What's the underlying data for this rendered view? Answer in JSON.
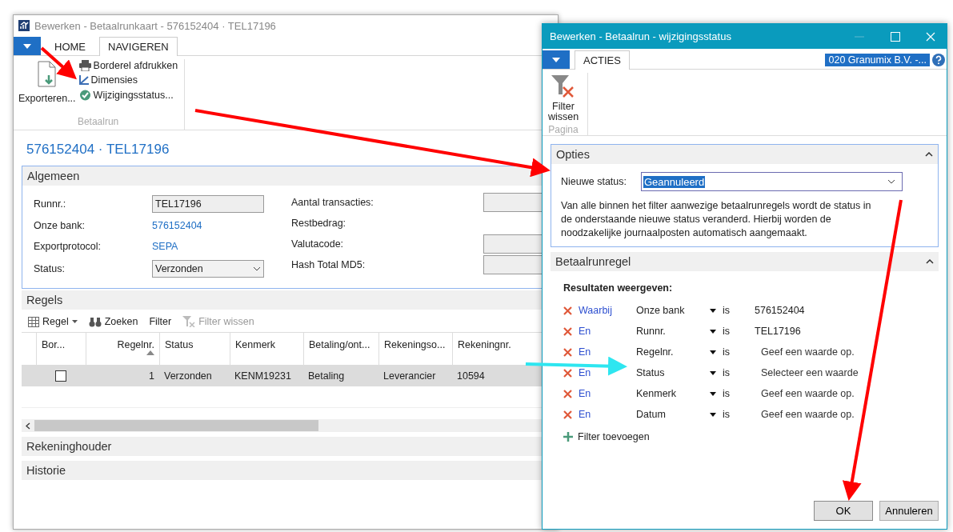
{
  "card_window": {
    "title": "Bewerken - Betaalrunkaart - 576152404 · TEL17196",
    "tabs": [
      {
        "label": "HOME",
        "selected": false
      },
      {
        "label": "NAVIGEREN",
        "selected": true
      }
    ],
    "ribbon": {
      "big_action": "Exporteren...",
      "actions": [
        {
          "label": "Borderel afdrukken",
          "kind": "print"
        },
        {
          "label": "Dimensies",
          "kind": "dimensions"
        },
        {
          "label": "Wijzigingsstatus...",
          "kind": "status"
        }
      ],
      "group": "Betaalrun"
    },
    "heading": "576152404 · TEL17196",
    "general": {
      "title": "Algemeen",
      "left_fields": [
        {
          "label": "Runnr.:",
          "kind": "box",
          "value": "TEL17196"
        },
        {
          "label": "Onze bank:",
          "kind": "link",
          "value": "576152404"
        },
        {
          "label": "Exportprotocol:",
          "kind": "link",
          "value": "SEPA"
        },
        {
          "label": "Status:",
          "kind": "select",
          "value": "Verzonden"
        }
      ],
      "right_fields": [
        {
          "label": "Aantal transacties:",
          "kind": "box"
        },
        {
          "label": "Restbedrag:",
          "kind": "plain"
        },
        {
          "label": "Valutacode:",
          "kind": "box"
        },
        {
          "label": "Hash Total MD5:",
          "kind": "box"
        }
      ]
    },
    "lines": {
      "title": "Regels",
      "toolbar": [
        {
          "label": "Regel",
          "kind": "grid",
          "disabled": false
        },
        {
          "label": "Zoeken",
          "kind": "find",
          "disabled": false
        },
        {
          "label": "Filter",
          "kind": "text",
          "disabled": false
        },
        {
          "label": "Filter wissen",
          "kind": "clear",
          "disabled": true
        }
      ],
      "columns": [
        {
          "label": "Bor...",
          "sorted": false
        },
        {
          "label": "Regelnr.",
          "sorted": true
        },
        {
          "label": "Status",
          "sorted": false
        },
        {
          "label": "Kenmerk",
          "sorted": false
        },
        {
          "label": "Betaling/ont...",
          "sorted": false
        },
        {
          "label": "Rekeningso...",
          "sorted": false
        },
        {
          "label": "Rekeningnr.",
          "sorted": false
        }
      ],
      "rows": [
        {
          "selected": true,
          "checked": false,
          "line_no": "1",
          "status": "Verzonden",
          "reference": "KENM19231",
          "type": "Betaling",
          "account_type": "Leverancier",
          "account_no": "10594"
        }
      ]
    },
    "collapsed_sections": [
      "Rekeninghouder",
      "Historie"
    ]
  },
  "dialog": {
    "title": "Bewerken - Betaalrun - wijzigingsstatus",
    "tabs": [
      {
        "label": "ACTIES",
        "selected": true
      }
    ],
    "company": "020 Granumix B.V. -...",
    "action": "Filter wissen",
    "action_group": "Pagina",
    "options": {
      "title": "Opties",
      "label": "Nieuwe status:",
      "value": "Geannuleerd",
      "description": "Van alle binnen het filter aanwezige betaalrunregels wordt de status in de onderstaande nieuwe status veranderd. Hierbij worden de noodzakelijke journaalposten automatisch aangemaakt."
    },
    "filter_section": {
      "title": "Betaalrunregel",
      "caption": "Resultaten weergeven:",
      "filters": [
        {
          "conjunction": "Waarbij",
          "field": "Onze bank",
          "operator": "is",
          "value": "576152404",
          "kind": "value"
        },
        {
          "conjunction": "En",
          "field": "Runnr.",
          "operator": "is",
          "value": "TEL17196",
          "kind": "value"
        },
        {
          "conjunction": "En",
          "field": "Regelnr.",
          "operator": "is",
          "value": "Geef een waarde op.",
          "kind": "hint"
        },
        {
          "conjunction": "En",
          "field": "Status",
          "operator": "is",
          "value": "Selecteer een waarde",
          "kind": "hint"
        },
        {
          "conjunction": "En",
          "field": "Kenmerk",
          "operator": "is",
          "value": "Geef een waarde op.",
          "kind": "hint"
        },
        {
          "conjunction": "En",
          "field": "Datum",
          "operator": "is",
          "value": "Geef een waarde op.",
          "kind": "hint"
        }
      ],
      "add": "Filter toevoegen"
    },
    "buttons": [
      {
        "label": "OK",
        "kind": "primary"
      },
      {
        "label": "Annuleren",
        "kind": "normal"
      }
    ]
  }
}
